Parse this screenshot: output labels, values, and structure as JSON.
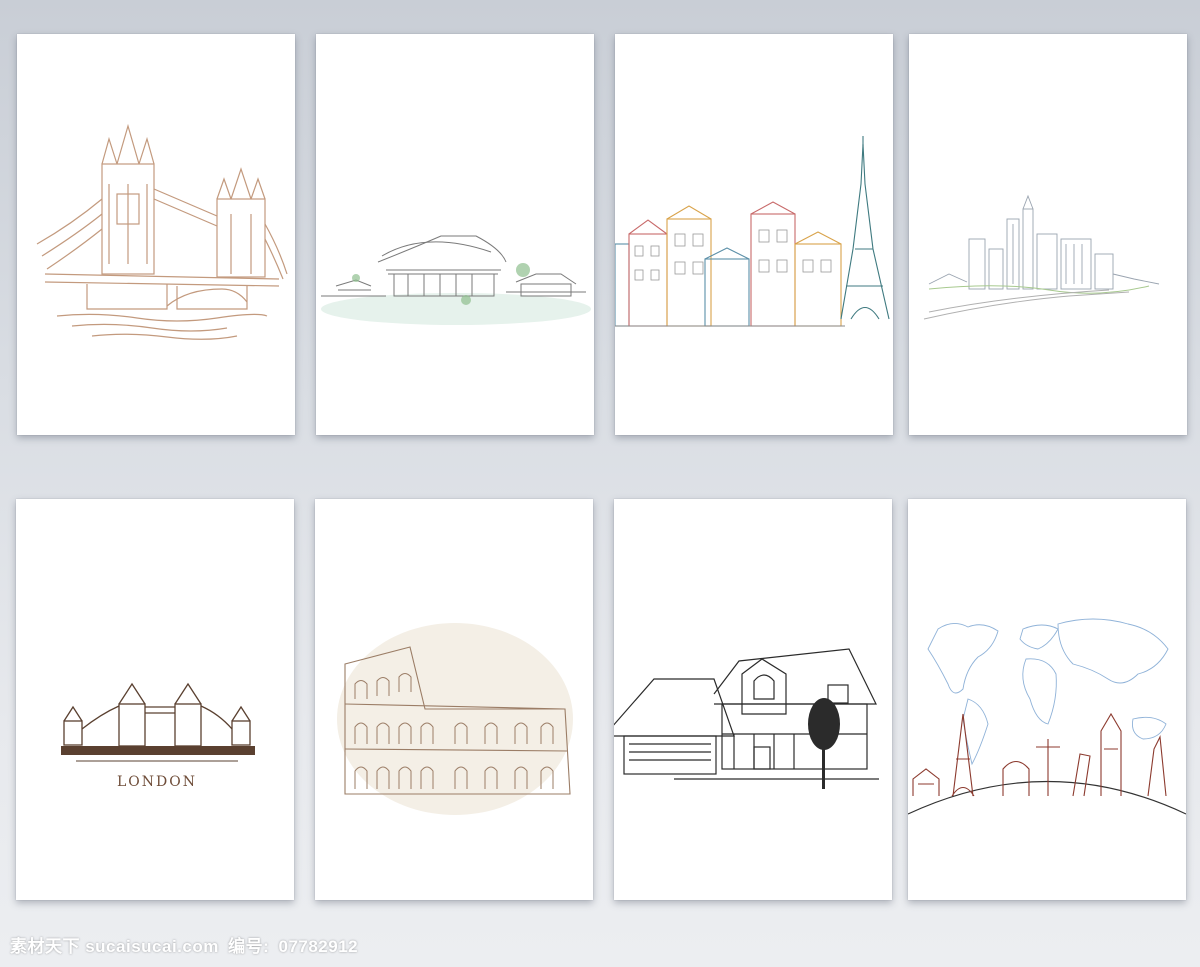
{
  "cards": [
    {
      "name": "tower-bridge-sketch",
      "stroke": "#c39a7e"
    },
    {
      "name": "chinese-palace-sketch",
      "stroke": "#7a7a7a"
    },
    {
      "name": "paris-street-sketch",
      "stroke": "#d9a34a"
    },
    {
      "name": "skyline-sketch",
      "stroke": "#9aa4b0"
    },
    {
      "name": "london-bridge-icon-card",
      "stroke": "#5a4030",
      "label": "LONDON"
    },
    {
      "name": "colosseum-sketch",
      "stroke": "#9b7d66"
    },
    {
      "name": "house-sketch",
      "stroke": "#2b2b2b"
    },
    {
      "name": "world-landmarks-card",
      "stroke": "#8c3a2e",
      "map_stroke": "#8fb2d8"
    }
  ],
  "watermark": {
    "site": "素材天下 sucaisucai.com",
    "id_label": "编号:",
    "id_value": "07782912"
  }
}
